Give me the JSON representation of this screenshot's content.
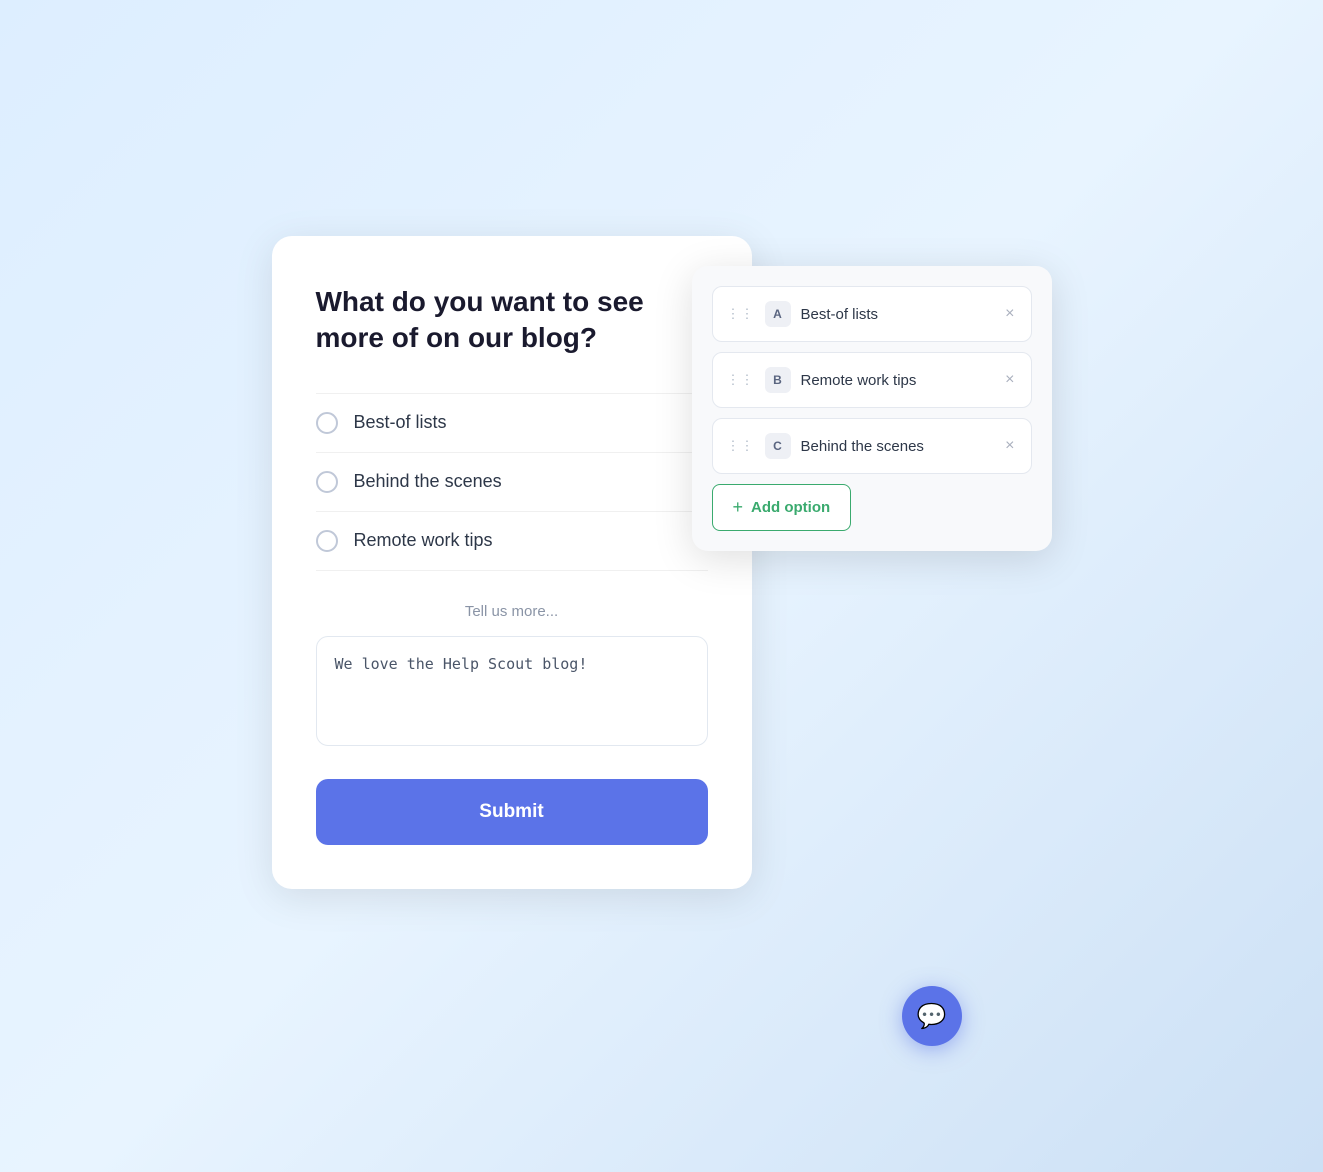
{
  "survey": {
    "title": "What do you want to see more of on our blog?",
    "options": [
      {
        "id": "opt-1",
        "label": "Best-of lists"
      },
      {
        "id": "opt-2",
        "label": "Behind the scenes"
      },
      {
        "id": "opt-3",
        "label": "Remote work tips"
      }
    ],
    "tell_us_more_label": "Tell us more...",
    "textarea_value": "We love the Help Scout blog!",
    "submit_label": "Submit"
  },
  "editor": {
    "rows": [
      {
        "badge": "A",
        "text": "Best-of lists"
      },
      {
        "badge": "B",
        "text": "Remote work tips"
      },
      {
        "badge": "C",
        "text": "Behind the scenes"
      }
    ],
    "add_option_label": "Add option"
  },
  "chat": {
    "icon": "💬"
  }
}
